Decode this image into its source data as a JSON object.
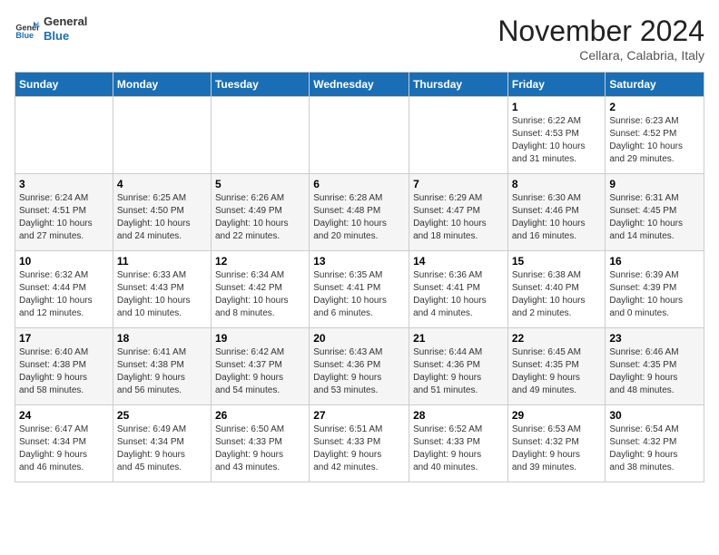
{
  "logo": {
    "line1": "General",
    "line2": "Blue"
  },
  "title": "November 2024",
  "subtitle": "Cellara, Calabria, Italy",
  "weekdays": [
    "Sunday",
    "Monday",
    "Tuesday",
    "Wednesday",
    "Thursday",
    "Friday",
    "Saturday"
  ],
  "weeks": [
    [
      {
        "day": "",
        "detail": ""
      },
      {
        "day": "",
        "detail": ""
      },
      {
        "day": "",
        "detail": ""
      },
      {
        "day": "",
        "detail": ""
      },
      {
        "day": "",
        "detail": ""
      },
      {
        "day": "1",
        "detail": "Sunrise: 6:22 AM\nSunset: 4:53 PM\nDaylight: 10 hours\nand 31 minutes."
      },
      {
        "day": "2",
        "detail": "Sunrise: 6:23 AM\nSunset: 4:52 PM\nDaylight: 10 hours\nand 29 minutes."
      }
    ],
    [
      {
        "day": "3",
        "detail": "Sunrise: 6:24 AM\nSunset: 4:51 PM\nDaylight: 10 hours\nand 27 minutes."
      },
      {
        "day": "4",
        "detail": "Sunrise: 6:25 AM\nSunset: 4:50 PM\nDaylight: 10 hours\nand 24 minutes."
      },
      {
        "day": "5",
        "detail": "Sunrise: 6:26 AM\nSunset: 4:49 PM\nDaylight: 10 hours\nand 22 minutes."
      },
      {
        "day": "6",
        "detail": "Sunrise: 6:28 AM\nSunset: 4:48 PM\nDaylight: 10 hours\nand 20 minutes."
      },
      {
        "day": "7",
        "detail": "Sunrise: 6:29 AM\nSunset: 4:47 PM\nDaylight: 10 hours\nand 18 minutes."
      },
      {
        "day": "8",
        "detail": "Sunrise: 6:30 AM\nSunset: 4:46 PM\nDaylight: 10 hours\nand 16 minutes."
      },
      {
        "day": "9",
        "detail": "Sunrise: 6:31 AM\nSunset: 4:45 PM\nDaylight: 10 hours\nand 14 minutes."
      }
    ],
    [
      {
        "day": "10",
        "detail": "Sunrise: 6:32 AM\nSunset: 4:44 PM\nDaylight: 10 hours\nand 12 minutes."
      },
      {
        "day": "11",
        "detail": "Sunrise: 6:33 AM\nSunset: 4:43 PM\nDaylight: 10 hours\nand 10 minutes."
      },
      {
        "day": "12",
        "detail": "Sunrise: 6:34 AM\nSunset: 4:42 PM\nDaylight: 10 hours\nand 8 minutes."
      },
      {
        "day": "13",
        "detail": "Sunrise: 6:35 AM\nSunset: 4:41 PM\nDaylight: 10 hours\nand 6 minutes."
      },
      {
        "day": "14",
        "detail": "Sunrise: 6:36 AM\nSunset: 4:41 PM\nDaylight: 10 hours\nand 4 minutes."
      },
      {
        "day": "15",
        "detail": "Sunrise: 6:38 AM\nSunset: 4:40 PM\nDaylight: 10 hours\nand 2 minutes."
      },
      {
        "day": "16",
        "detail": "Sunrise: 6:39 AM\nSunset: 4:39 PM\nDaylight: 10 hours\nand 0 minutes."
      }
    ],
    [
      {
        "day": "17",
        "detail": "Sunrise: 6:40 AM\nSunset: 4:38 PM\nDaylight: 9 hours\nand 58 minutes."
      },
      {
        "day": "18",
        "detail": "Sunrise: 6:41 AM\nSunset: 4:38 PM\nDaylight: 9 hours\nand 56 minutes."
      },
      {
        "day": "19",
        "detail": "Sunrise: 6:42 AM\nSunset: 4:37 PM\nDaylight: 9 hours\nand 54 minutes."
      },
      {
        "day": "20",
        "detail": "Sunrise: 6:43 AM\nSunset: 4:36 PM\nDaylight: 9 hours\nand 53 minutes."
      },
      {
        "day": "21",
        "detail": "Sunrise: 6:44 AM\nSunset: 4:36 PM\nDaylight: 9 hours\nand 51 minutes."
      },
      {
        "day": "22",
        "detail": "Sunrise: 6:45 AM\nSunset: 4:35 PM\nDaylight: 9 hours\nand 49 minutes."
      },
      {
        "day": "23",
        "detail": "Sunrise: 6:46 AM\nSunset: 4:35 PM\nDaylight: 9 hours\nand 48 minutes."
      }
    ],
    [
      {
        "day": "24",
        "detail": "Sunrise: 6:47 AM\nSunset: 4:34 PM\nDaylight: 9 hours\nand 46 minutes."
      },
      {
        "day": "25",
        "detail": "Sunrise: 6:49 AM\nSunset: 4:34 PM\nDaylight: 9 hours\nand 45 minutes."
      },
      {
        "day": "26",
        "detail": "Sunrise: 6:50 AM\nSunset: 4:33 PM\nDaylight: 9 hours\nand 43 minutes."
      },
      {
        "day": "27",
        "detail": "Sunrise: 6:51 AM\nSunset: 4:33 PM\nDaylight: 9 hours\nand 42 minutes."
      },
      {
        "day": "28",
        "detail": "Sunrise: 6:52 AM\nSunset: 4:33 PM\nDaylight: 9 hours\nand 40 minutes."
      },
      {
        "day": "29",
        "detail": "Sunrise: 6:53 AM\nSunset: 4:32 PM\nDaylight: 9 hours\nand 39 minutes."
      },
      {
        "day": "30",
        "detail": "Sunrise: 6:54 AM\nSunset: 4:32 PM\nDaylight: 9 hours\nand 38 minutes."
      }
    ]
  ]
}
